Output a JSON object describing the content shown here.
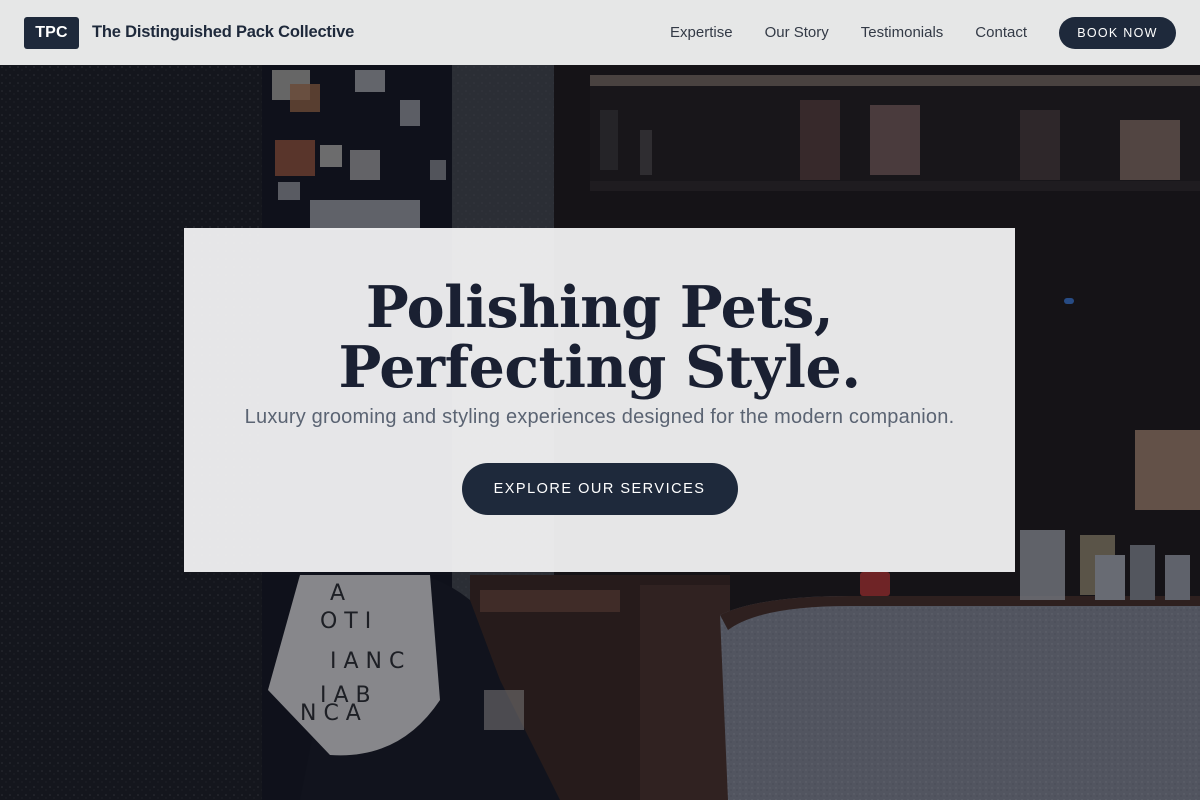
{
  "header": {
    "logo_text": "TPC",
    "brand_name": "The Distinguished Pack Collective",
    "nav": [
      {
        "label": "Expertise"
      },
      {
        "label": "Our Story"
      },
      {
        "label": "Testimonials"
      },
      {
        "label": "Contact"
      }
    ],
    "cta_label": "BOOK NOW"
  },
  "hero": {
    "title_line1": "Polishing Pets,",
    "title_line2": "Perfecting Style.",
    "subtitle": "Luxury grooming and styling experiences designed for the modern companion.",
    "cta_label": "EXPLORE OUR SERVICES",
    "background_description_icon": "photo-storefront",
    "tote_letters": "A T O I T I A N C I A B N C A"
  },
  "colors": {
    "primary": "#1e293b",
    "header_bg": "#f2f2f2",
    "card_bg": "#f6f6f8",
    "subtitle": "#5b6473"
  }
}
